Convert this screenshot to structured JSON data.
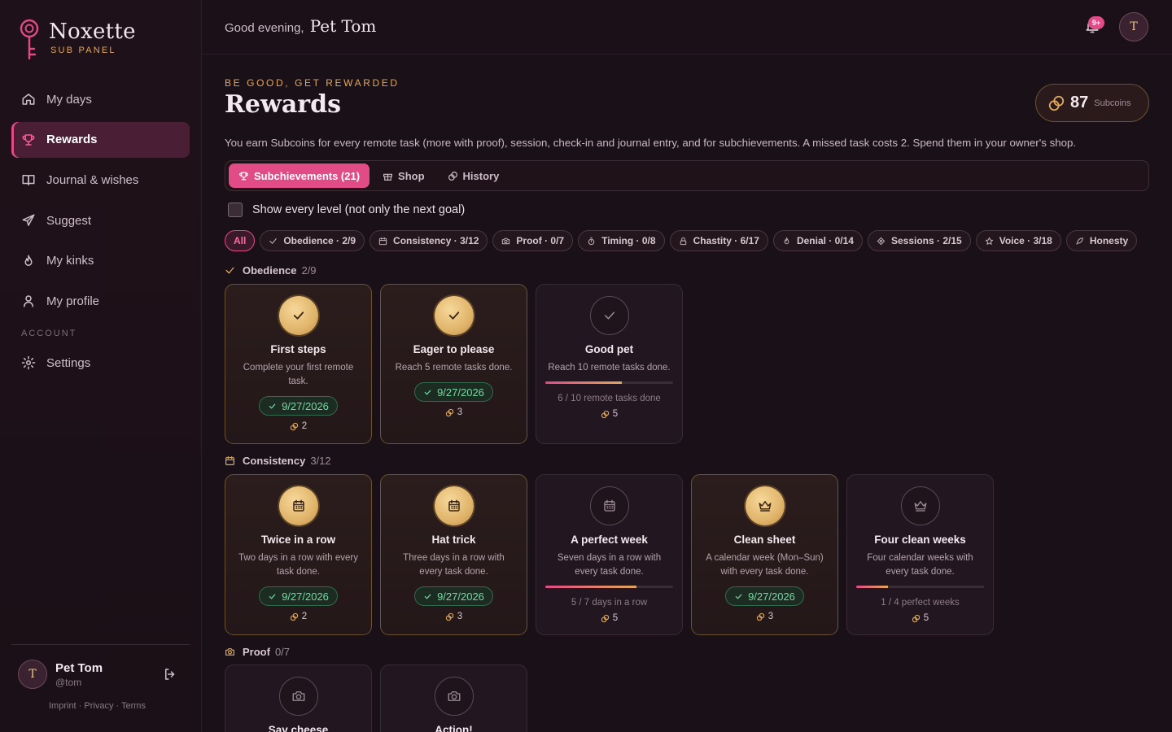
{
  "brand": {
    "name": "Noxette",
    "subtitle": "SUB PANEL"
  },
  "nav": {
    "items": [
      {
        "label": "My days",
        "icon": "home-icon"
      },
      {
        "label": "Rewards",
        "icon": "trophy-icon",
        "active": true
      },
      {
        "label": "Journal & wishes",
        "icon": "book-icon"
      },
      {
        "label": "Suggest",
        "icon": "send-icon"
      },
      {
        "label": "My kinks",
        "icon": "flame-icon"
      },
      {
        "label": "My profile",
        "icon": "user-icon"
      }
    ],
    "account_label": "ACCOUNT",
    "settings_label": "Settings"
  },
  "user": {
    "name": "Pet Tom",
    "handle": "@tom",
    "initial": "T"
  },
  "footer_links": "Imprint · Privacy · Terms",
  "topbar": {
    "greeting": "Good evening,",
    "name": "Pet Tom",
    "notifications_badge": "9+",
    "avatar_initial": "T"
  },
  "page": {
    "eyebrow": "BE GOOD, GET REWARDED",
    "title": "Rewards",
    "coins_amount": "87",
    "coins_unit": "Subcoins",
    "intro": "You earn Subcoins for every remote task (more with proof), session, check-in and journal entry, and for subchievements. A missed task costs 2. Spend them in your owner's shop."
  },
  "tabs": [
    {
      "label": "Subchievements (21)",
      "icon": "trophy-icon",
      "active": true
    },
    {
      "label": "Shop",
      "icon": "gift-icon"
    },
    {
      "label": "History",
      "icon": "coins-icon"
    }
  ],
  "show_every_level_label": "Show every level (not only the next goal)",
  "filters": [
    {
      "label": "All",
      "active": true
    },
    {
      "label": "Obedience · 2/9",
      "icon": "check-icon"
    },
    {
      "label": "Consistency · 3/12",
      "icon": "calendar-icon"
    },
    {
      "label": "Proof · 0/7",
      "icon": "camera-icon"
    },
    {
      "label": "Timing · 0/8",
      "icon": "timer-icon"
    },
    {
      "label": "Chastity · 6/17",
      "icon": "lock-icon"
    },
    {
      "label": "Denial · 0/14",
      "icon": "flame-icon"
    },
    {
      "label": "Sessions · 2/15",
      "icon": "diamond-icon"
    },
    {
      "label": "Voice · 3/18",
      "icon": "star-icon"
    },
    {
      "label": "Honesty",
      "icon": "feather-icon"
    }
  ],
  "sections": [
    {
      "name": "Obedience",
      "count": "2/9",
      "icon": "check-icon",
      "cards": [
        {
          "title": "First steps",
          "desc": "Complete your first remote task.",
          "earned": true,
          "date": "9/27/2026",
          "reward": "2",
          "icon": "check-icon"
        },
        {
          "title": "Eager to please",
          "desc": "Reach 5 remote tasks done.",
          "earned": true,
          "date": "9/27/2026",
          "reward": "3",
          "icon": "check-icon"
        },
        {
          "title": "Good pet",
          "desc": "Reach 10 remote tasks done.",
          "earned": false,
          "progress": 0.6,
          "progress_text": "6 / 10 remote tasks done",
          "reward": "5",
          "icon": "check-icon"
        }
      ]
    },
    {
      "name": "Consistency",
      "count": "3/12",
      "icon": "calendar-icon",
      "cards": [
        {
          "title": "Twice in a row",
          "desc": "Two days in a row with every task done.",
          "earned": true,
          "date": "9/27/2026",
          "reward": "2",
          "icon": "calendar-icon"
        },
        {
          "title": "Hat trick",
          "desc": "Three days in a row with every task done.",
          "earned": true,
          "date": "9/27/2026",
          "reward": "3",
          "icon": "calendar-icon"
        },
        {
          "title": "A perfect week",
          "desc": "Seven days in a row with every task done.",
          "earned": false,
          "progress": 0.714,
          "progress_text": "5 / 7 days in a row",
          "reward": "5",
          "icon": "calendar-icon"
        },
        {
          "title": "Clean sheet",
          "desc": "A calendar week (Mon–Sun) with every task done.",
          "earned": true,
          "date": "9/27/2026",
          "reward": "3",
          "icon": "crown-icon"
        },
        {
          "title": "Four clean weeks",
          "desc": "Four calendar weeks with every task done.",
          "earned": false,
          "progress": 0.25,
          "progress_text": "1 / 4 perfect weeks",
          "reward": "5",
          "icon": "crown-icon"
        }
      ]
    },
    {
      "name": "Proof",
      "count": "0/7",
      "icon": "camera-icon",
      "cards": [
        {
          "title": "Say cheese",
          "earned": false,
          "icon": "camera-icon"
        },
        {
          "title": "Action!",
          "earned": false,
          "icon": "camera-icon"
        }
      ]
    }
  ],
  "colors": {
    "accent": "#e14b86",
    "gold": "#e0a85a",
    "success": "#73d9a0",
    "background": "#1a1018"
  }
}
